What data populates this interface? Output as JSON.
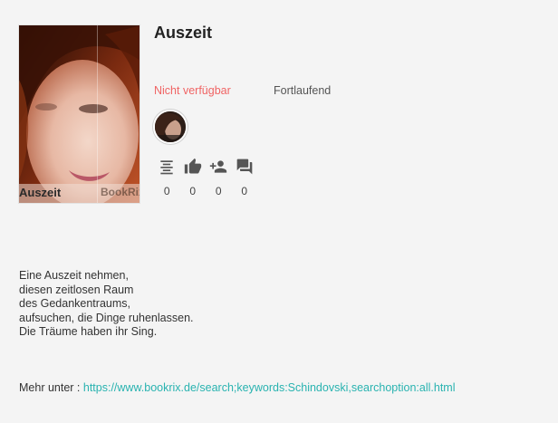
{
  "book": {
    "title": "Auszeit",
    "cover": {
      "title_text": "Auszeit",
      "brand_text": "BookRix"
    },
    "availability": "Nicht verfügbar",
    "progress_status": "Fortlaufend",
    "stats": [
      {
        "icon": "text-lines-icon",
        "count": "0"
      },
      {
        "icon": "thumbs-up-icon",
        "count": "0"
      },
      {
        "icon": "add-person-icon",
        "count": "0"
      },
      {
        "icon": "comments-icon",
        "count": "0"
      }
    ],
    "description_lines": [
      "Eine Auszeit nehmen,",
      "diesen zeitlosen Raum",
      "des Gedankentraums,",
      "aufsuchen, die Dinge ruhenlassen.",
      "Die Träume haben ihr Sing."
    ],
    "more": {
      "label": "Mehr unter : ",
      "link_text": "https://www.bookrix.de/search;keywords:Schindovski,searchoption:all.html"
    }
  },
  "colors": {
    "background": "#f4f4f4",
    "unavailable": "#f06464",
    "link": "#29b3b0",
    "icon": "#555555"
  }
}
